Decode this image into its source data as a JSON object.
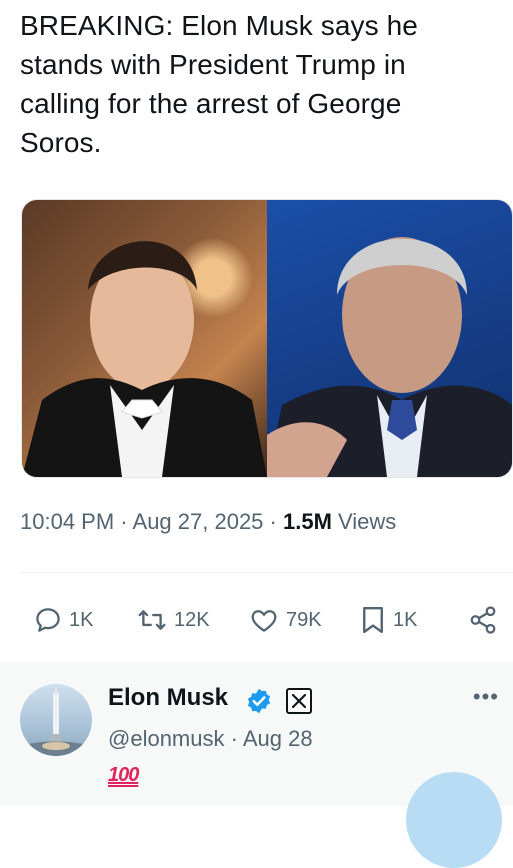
{
  "tweet": {
    "text": "BREAKING: Elon Musk says he stands with President Trump in calling for the arrest of George Soros.",
    "time": "10:04 PM",
    "separator_1": " · ",
    "date": "Aug 27, 2025",
    "separator_2": " · ",
    "views_count": "1.5M",
    "views_label": " Views"
  },
  "actions": {
    "replies": "1K",
    "reposts": "12K",
    "likes": "79K",
    "bookmarks": "1K"
  },
  "reply": {
    "author_name": "Elon Musk",
    "handle": "@elonmusk",
    "separator": " · ",
    "date": "Aug 28",
    "body_emoji": "100",
    "more_label": "•••"
  },
  "colors": {
    "text": "#0f1419",
    "muted": "#536471",
    "verified": "#1d9bf0",
    "emoji": "#e0245e"
  }
}
